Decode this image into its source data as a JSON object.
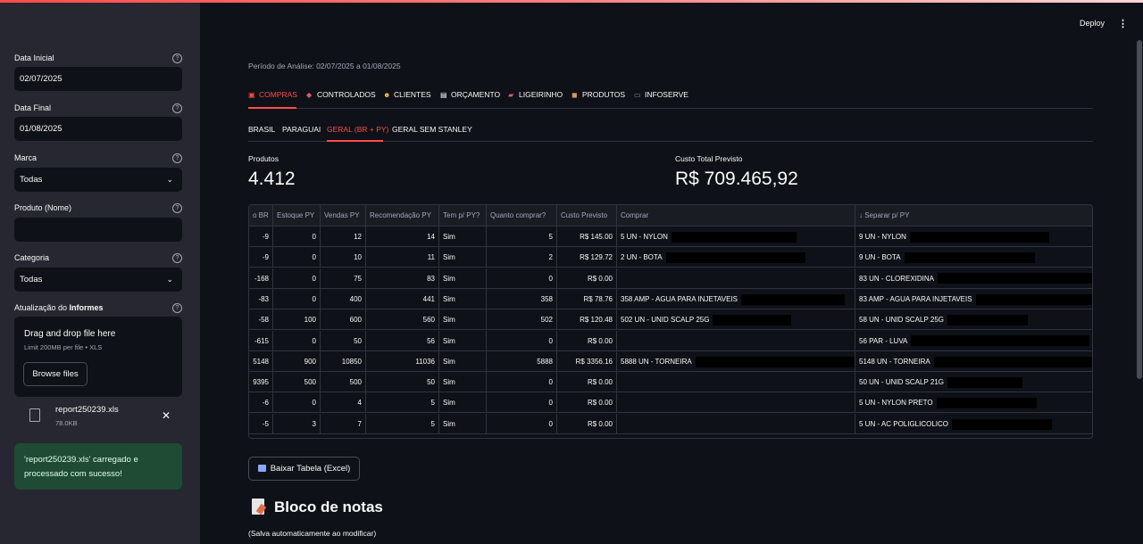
{
  "sidebar": {
    "data_inicial_label": "Data Inicial",
    "data_inicial_value": "02/07/2025",
    "data_final_label": "Data Final",
    "data_final_value": "01/08/2025",
    "marca_label": "Marca",
    "marca_value": "Todas",
    "produto_label": "Produto (Nome)",
    "produto_value": "",
    "categoria_label": "Categoria",
    "categoria_value": "Todas",
    "atualizacao_label_pre": "Atualização do ",
    "atualizacao_label_bold": "Informes",
    "help_glyph": "?",
    "chevron_glyph": "⌄",
    "upload": {
      "title": "Drag and drop file here",
      "limit": "Limit 200MB per file • XLS",
      "browse_label": "Browse files"
    },
    "file": {
      "name": "report250239.xls",
      "size": "78.0KB",
      "remove_glyph": "✕"
    },
    "success_message": "'report250239.xls' carregado e processado com sucesso!"
  },
  "header": {
    "deploy_label": "Deploy",
    "menu_glyph": "⋮"
  },
  "main": {
    "periodo": "Período de Análise: 02/07/2025 a 01/08/2025",
    "tabs": [
      {
        "label": "COMPRAS",
        "icon": "cart-icon",
        "glyph": "▣"
      },
      {
        "label": "CONTROLADOS",
        "icon": "pill-icon",
        "glyph": "◆"
      },
      {
        "label": "CLIENTES",
        "icon": "smile-icon",
        "glyph": "☻"
      },
      {
        "label": "ORÇAMENTO",
        "icon": "document-icon",
        "glyph": "▤"
      },
      {
        "label": "LIGEIRINHO",
        "icon": "truck-icon",
        "glyph": "▰"
      },
      {
        "label": "PRODUTOS",
        "icon": "box-icon",
        "glyph": "◼"
      },
      {
        "label": "INFOSERVE",
        "icon": "computer-icon",
        "glyph": "▭"
      }
    ],
    "subtabs": [
      "BRASIL",
      "PARAGUAI",
      "GERAL (BR + PY)",
      "GERAL SEM STANLEY"
    ],
    "metrics": {
      "produtos_label": "Produtos",
      "produtos_value": "4.412",
      "custo_label": "Custo Total Previsto",
      "custo_value": "R$ 709.465,92"
    },
    "table": {
      "columns": [
        "o BR",
        "Estoque PY",
        "Vendas PY",
        "Recomendação PY",
        "Tem p/ PY?",
        "Quanto comprar?",
        "Custo Previsto",
        "Comprar",
        "↓ Separar p/ PY"
      ],
      "rows": [
        [
          "-9",
          "0",
          "12",
          "14",
          "Sim",
          "5",
          "R$ 145.00",
          "5 UN - NYLON",
          "9 UN - NYLON"
        ],
        [
          "-9",
          "0",
          "10",
          "11",
          "Sim",
          "2",
          "R$ 129.72",
          "2 UN - BOTA",
          "9 UN - BOTA"
        ],
        [
          "-168",
          "0",
          "75",
          "83",
          "Sim",
          "0",
          "R$ 0.00",
          "",
          "83 UN - CLOREXIDINA"
        ],
        [
          "-83",
          "0",
          "400",
          "441",
          "Sim",
          "358",
          "R$ 78.76",
          "358 AMP - AGUA PARA INJETAVEIS",
          "83 AMP - AGUA PARA INJETAVEIS"
        ],
        [
          "-58",
          "100",
          "600",
          "560",
          "Sim",
          "502",
          "R$ 120.48",
          "502 UN - UNID SCALP 25G",
          "58 UN - UNID SCALP 25G"
        ],
        [
          "-615",
          "0",
          "50",
          "56",
          "Sim",
          "0",
          "R$ 0.00",
          "",
          "56 PAR - LUVA"
        ],
        [
          "5148",
          "900",
          "10850",
          "11036",
          "Sim",
          "5888",
          "R$ 3356.16",
          "5888 UN - TORNEIRA",
          "5148 UN - TORNEIRA"
        ],
        [
          "9395",
          "500",
          "500",
          "50",
          "Sim",
          "0",
          "R$ 0.00",
          "",
          "50 UN - UNID SCALP 21G"
        ],
        [
          "-6",
          "0",
          "4",
          "5",
          "Sim",
          "0",
          "R$ 0.00",
          "",
          "5 UN - NYLON PRETO"
        ],
        [
          "-5",
          "3",
          "7",
          "5",
          "Sim",
          "0",
          "R$ 0.00",
          "",
          "5 UN - AC POLIGLICOLICO"
        ]
      ]
    },
    "download_label": "Baixar Tabela (Excel)",
    "notes_title": "Bloco de notas",
    "notes_subtitle": "(Salva automaticamente ao modificar)"
  }
}
